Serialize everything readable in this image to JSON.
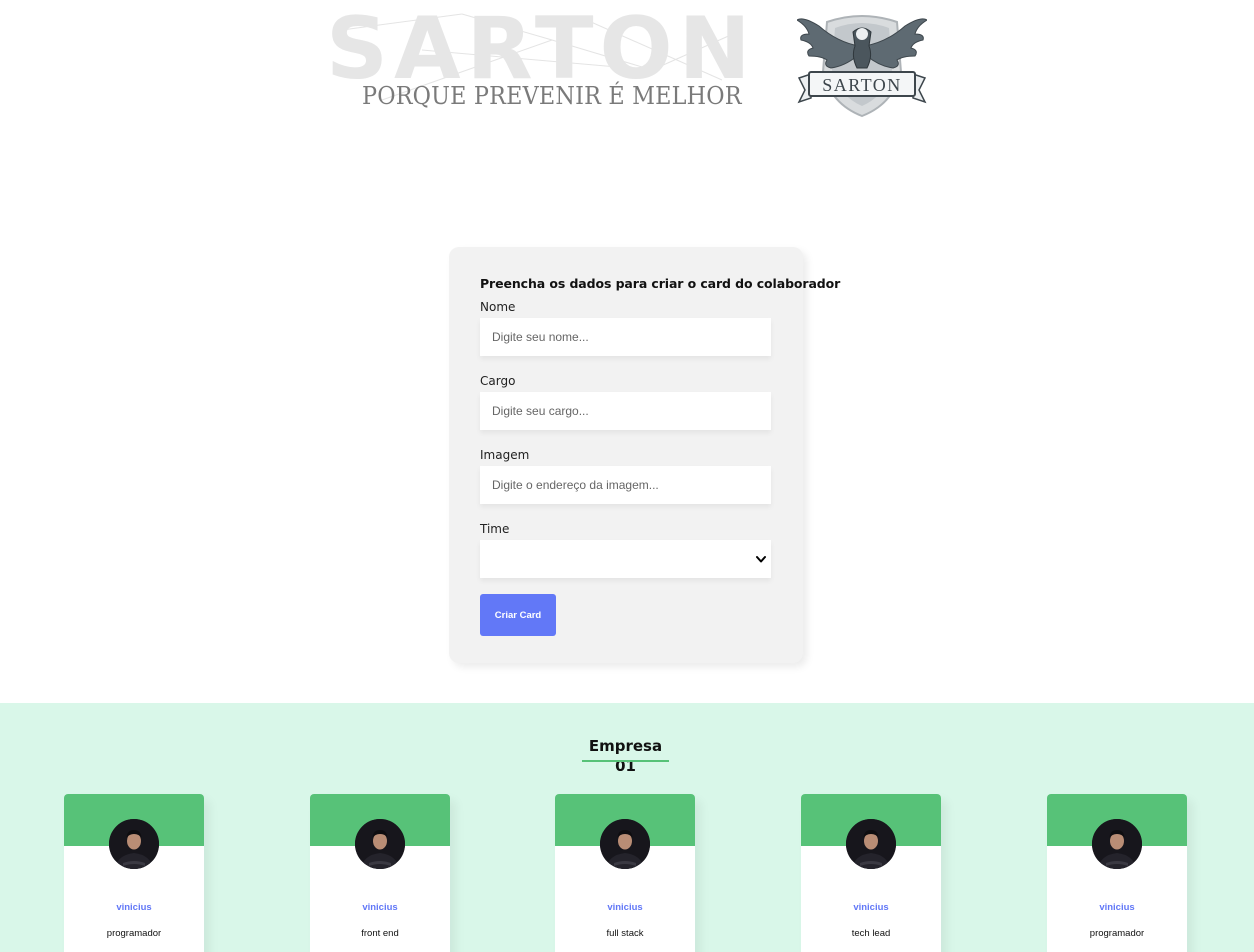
{
  "banner": {
    "brand_wordmark": "SARTON",
    "slogan": "PORQUE PREVENIR É MELHOR",
    "logo_text": "SARTON"
  },
  "form": {
    "title": "Preencha os dados para criar o card do colaborador",
    "fields": [
      {
        "label": "Nome",
        "placeholder": "Digite seu nome..."
      },
      {
        "label": "Cargo",
        "placeholder": "Digite seu cargo..."
      },
      {
        "label": "Imagem",
        "placeholder": "Digite o endereço da imagem..."
      }
    ],
    "team_select": {
      "label": "Time",
      "selected": ""
    },
    "submit_label": "Criar Card"
  },
  "team": {
    "name": "Empresa 01",
    "primary_color": "#57c278",
    "secondary_color": "#d9f7e9",
    "members": [
      {
        "name": "vinicius",
        "role": "programador"
      },
      {
        "name": "vinicius",
        "role": "front end"
      },
      {
        "name": "vinicius",
        "role": "full stack"
      },
      {
        "name": "vinicius",
        "role": "tech lead"
      },
      {
        "name": "vinicius",
        "role": "programador"
      }
    ]
  },
  "colors": {
    "accent": "#6278f7",
    "form_background": "#f2f2f2"
  }
}
